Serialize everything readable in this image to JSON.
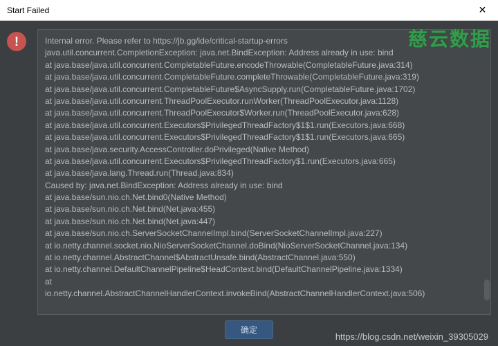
{
  "titlebar": {
    "title": "Start Failed",
    "close": "✕"
  },
  "icon": {
    "glyph": "!"
  },
  "watermark": "慈云数据",
  "message": {
    "intro": "Internal error. Please refer to https://jb.gg/ide/critical-startup-errors",
    "blank": "",
    "l1": "java.util.concurrent.CompletionException: java.net.BindException: Address already in use: bind",
    "l2": "    at java.base/java.util.concurrent.CompletableFuture.encodeThrowable(CompletableFuture.java:314)",
    "l3": "    at java.base/java.util.concurrent.CompletableFuture.completeThrowable(CompletableFuture.java:319)",
    "l4": "    at java.base/java.util.concurrent.CompletableFuture$AsyncSupply.run(CompletableFuture.java:1702)",
    "l5": "    at java.base/java.util.concurrent.ThreadPoolExecutor.runWorker(ThreadPoolExecutor.java:1128)",
    "l6": "    at java.base/java.util.concurrent.ThreadPoolExecutor$Worker.run(ThreadPoolExecutor.java:628)",
    "l7": "    at java.base/java.util.concurrent.Executors$PrivilegedThreadFactory$1$1.run(Executors.java:668)",
    "l8": "    at java.base/java.util.concurrent.Executors$PrivilegedThreadFactory$1$1.run(Executors.java:665)",
    "l9": "    at java.base/java.security.AccessController.doPrivileged(Native Method)",
    "l10": "    at java.base/java.util.concurrent.Executors$PrivilegedThreadFactory$1.run(Executors.java:665)",
    "l11": "    at java.base/java.lang.Thread.run(Thread.java:834)",
    "l12": "Caused by: java.net.BindException: Address already in use: bind",
    "l13": "    at java.base/sun.nio.ch.Net.bind0(Native Method)",
    "l14": "    at java.base/sun.nio.ch.Net.bind(Net.java:455)",
    "l15": "    at java.base/sun.nio.ch.Net.bind(Net.java:447)",
    "l16": "    at java.base/sun.nio.ch.ServerSocketChannelImpl.bind(ServerSocketChannelImpl.java:227)",
    "l17": "    at io.netty.channel.socket.nio.NioServerSocketChannel.doBind(NioServerSocketChannel.java:134)",
    "l18": "    at io.netty.channel.AbstractChannel$AbstractUnsafe.bind(AbstractChannel.java:550)",
    "l19": "    at io.netty.channel.DefaultChannelPipeline$HeadContext.bind(DefaultChannelPipeline.java:1334)",
    "l20": "    at",
    "l21": "io.netty.channel.AbstractChannelHandlerContext.invokeBind(AbstractChannelHandlerContext.java:506)"
  },
  "buttons": {
    "ok": "确定"
  },
  "footer": {
    "url": "https://blog.csdn.net/weixin_39305029"
  }
}
